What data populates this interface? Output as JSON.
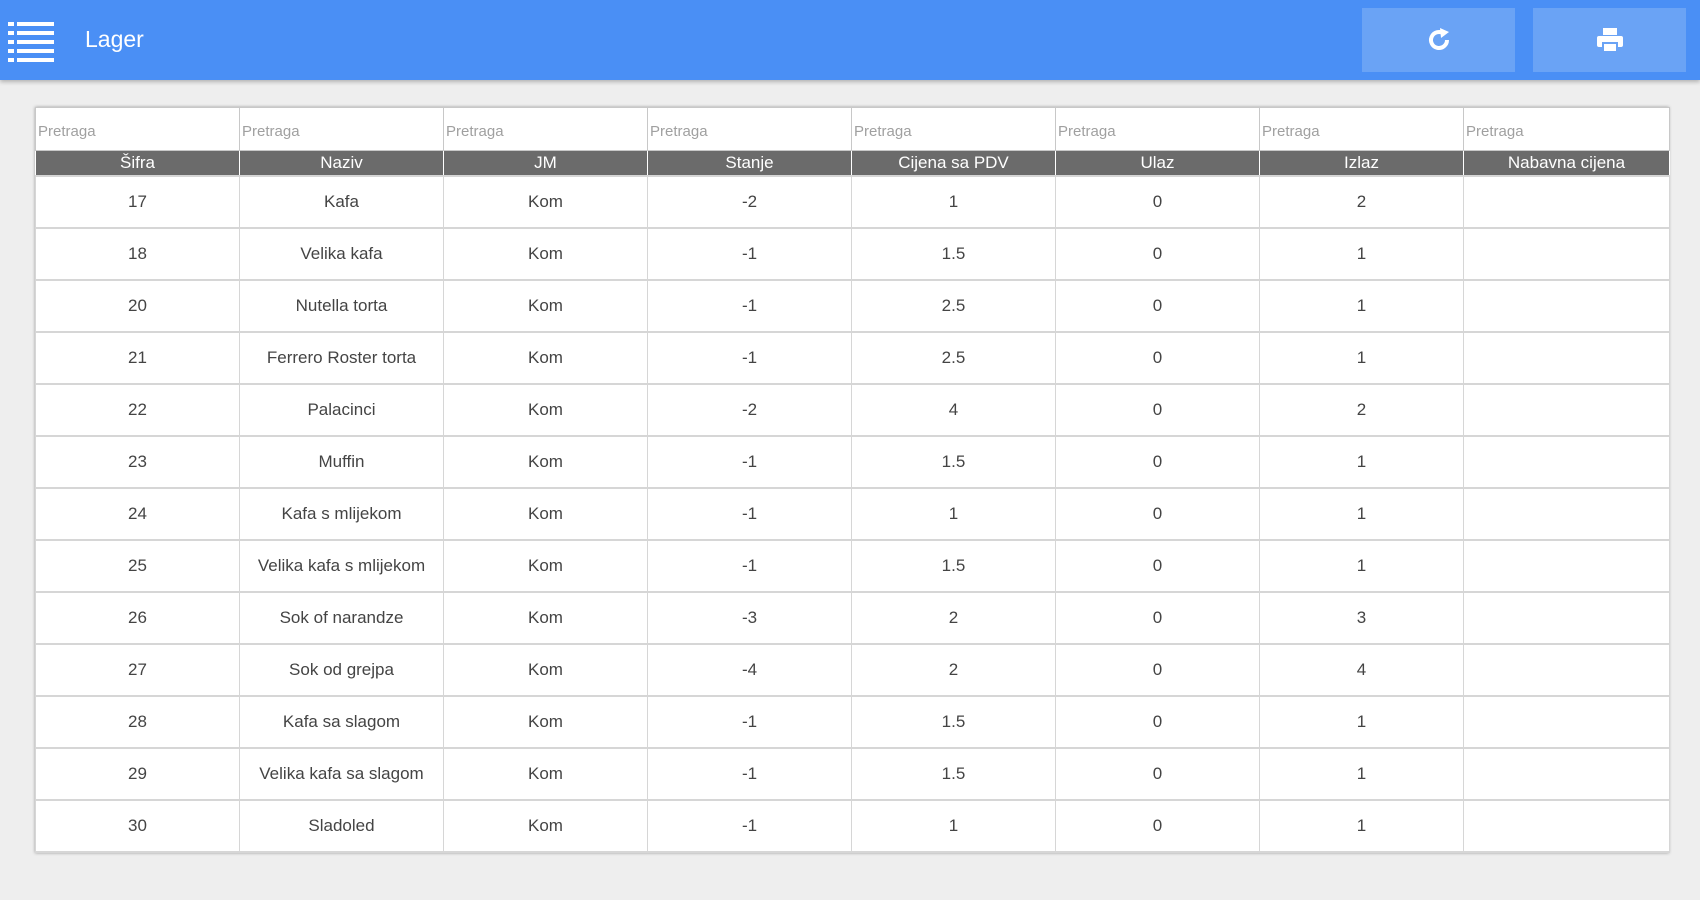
{
  "app": {
    "title": "Lager"
  },
  "toolbar": {
    "menu_icon": "hamburger-list-icon",
    "refresh_icon": "refresh-icon",
    "print_icon": "printer-icon"
  },
  "colors": {
    "topbar": "#4a8ff5",
    "toolbar_button": "#6aa3f5",
    "header_row": "#6b6b6b"
  },
  "table": {
    "search_placeholder": "Pretraga",
    "columns": [
      "Šifra",
      "Naziv",
      "JM",
      "Stanje",
      "Cijena sa PDV",
      "Ulaz",
      "Izlaz",
      "Nabavna cijena"
    ],
    "rows": [
      [
        "17",
        "Kafa",
        "Kom",
        "-2",
        "1",
        "0",
        "2",
        ""
      ],
      [
        "18",
        "Velika kafa",
        "Kom",
        "-1",
        "1.5",
        "0",
        "1",
        ""
      ],
      [
        "20",
        "Nutella torta",
        "Kom",
        "-1",
        "2.5",
        "0",
        "1",
        ""
      ],
      [
        "21",
        "Ferrero Roster torta",
        "Kom",
        "-1",
        "2.5",
        "0",
        "1",
        ""
      ],
      [
        "22",
        "Palacinci",
        "Kom",
        "-2",
        "4",
        "0",
        "2",
        ""
      ],
      [
        "23",
        "Muffin",
        "Kom",
        "-1",
        "1.5",
        "0",
        "1",
        ""
      ],
      [
        "24",
        "Kafa s mlijekom",
        "Kom",
        "-1",
        "1",
        "0",
        "1",
        ""
      ],
      [
        "25",
        "Velika kafa s mlijekom",
        "Kom",
        "-1",
        "1.5",
        "0",
        "1",
        ""
      ],
      [
        "26",
        "Sok of narandze",
        "Kom",
        "-3",
        "2",
        "0",
        "3",
        ""
      ],
      [
        "27",
        "Sok od grejpa",
        "Kom",
        "-4",
        "2",
        "0",
        "4",
        ""
      ],
      [
        "28",
        "Kafa sa slagom",
        "Kom",
        "-1",
        "1.5",
        "0",
        "1",
        ""
      ],
      [
        "29",
        "Velika kafa sa slagom",
        "Kom",
        "-1",
        "1.5",
        "0",
        "1",
        ""
      ],
      [
        "30",
        "Sladoled",
        "Kom",
        "-1",
        "1",
        "0",
        "1",
        ""
      ]
    ]
  }
}
